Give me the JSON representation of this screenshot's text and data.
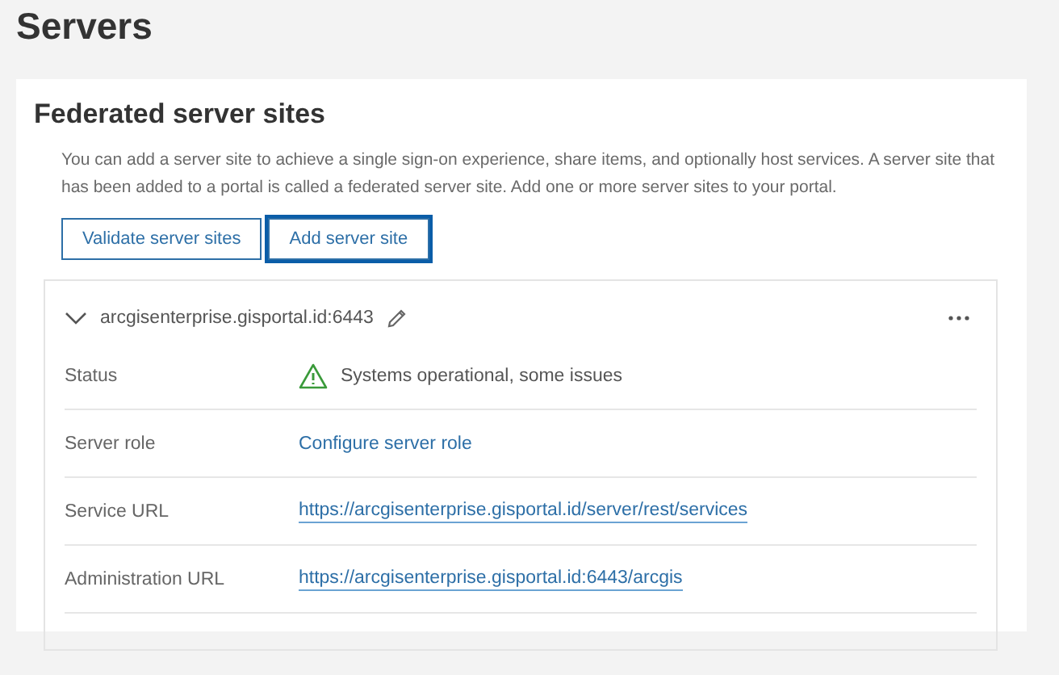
{
  "page_title": "Servers",
  "section": {
    "title": "Federated server sites",
    "description": "You can add a server site to achieve a single sign-on experience, share items, and optionally host services. A server site that has been added to a portal is called a federated server site. Add one or more server sites to your portal.",
    "buttons": [
      {
        "label": "Validate server sites",
        "focused": false
      },
      {
        "label": "Add server site",
        "focused": true
      }
    ],
    "site": {
      "name": "arcgisenterprise.gisportal.id:6443",
      "expanded": true,
      "rows": [
        {
          "label": "Status",
          "kind": "status",
          "value": "Systems operational, some issues"
        },
        {
          "label": "Server role",
          "kind": "link",
          "value": "Configure server role"
        },
        {
          "label": "Service URL",
          "kind": "url",
          "value": "https://arcgisenterprise.gisportal.id/server/rest/services"
        },
        {
          "label": "Administration URL",
          "kind": "url",
          "value": "https://arcgisenterprise.gisportal.id:6443/arcgis"
        }
      ]
    }
  }
}
